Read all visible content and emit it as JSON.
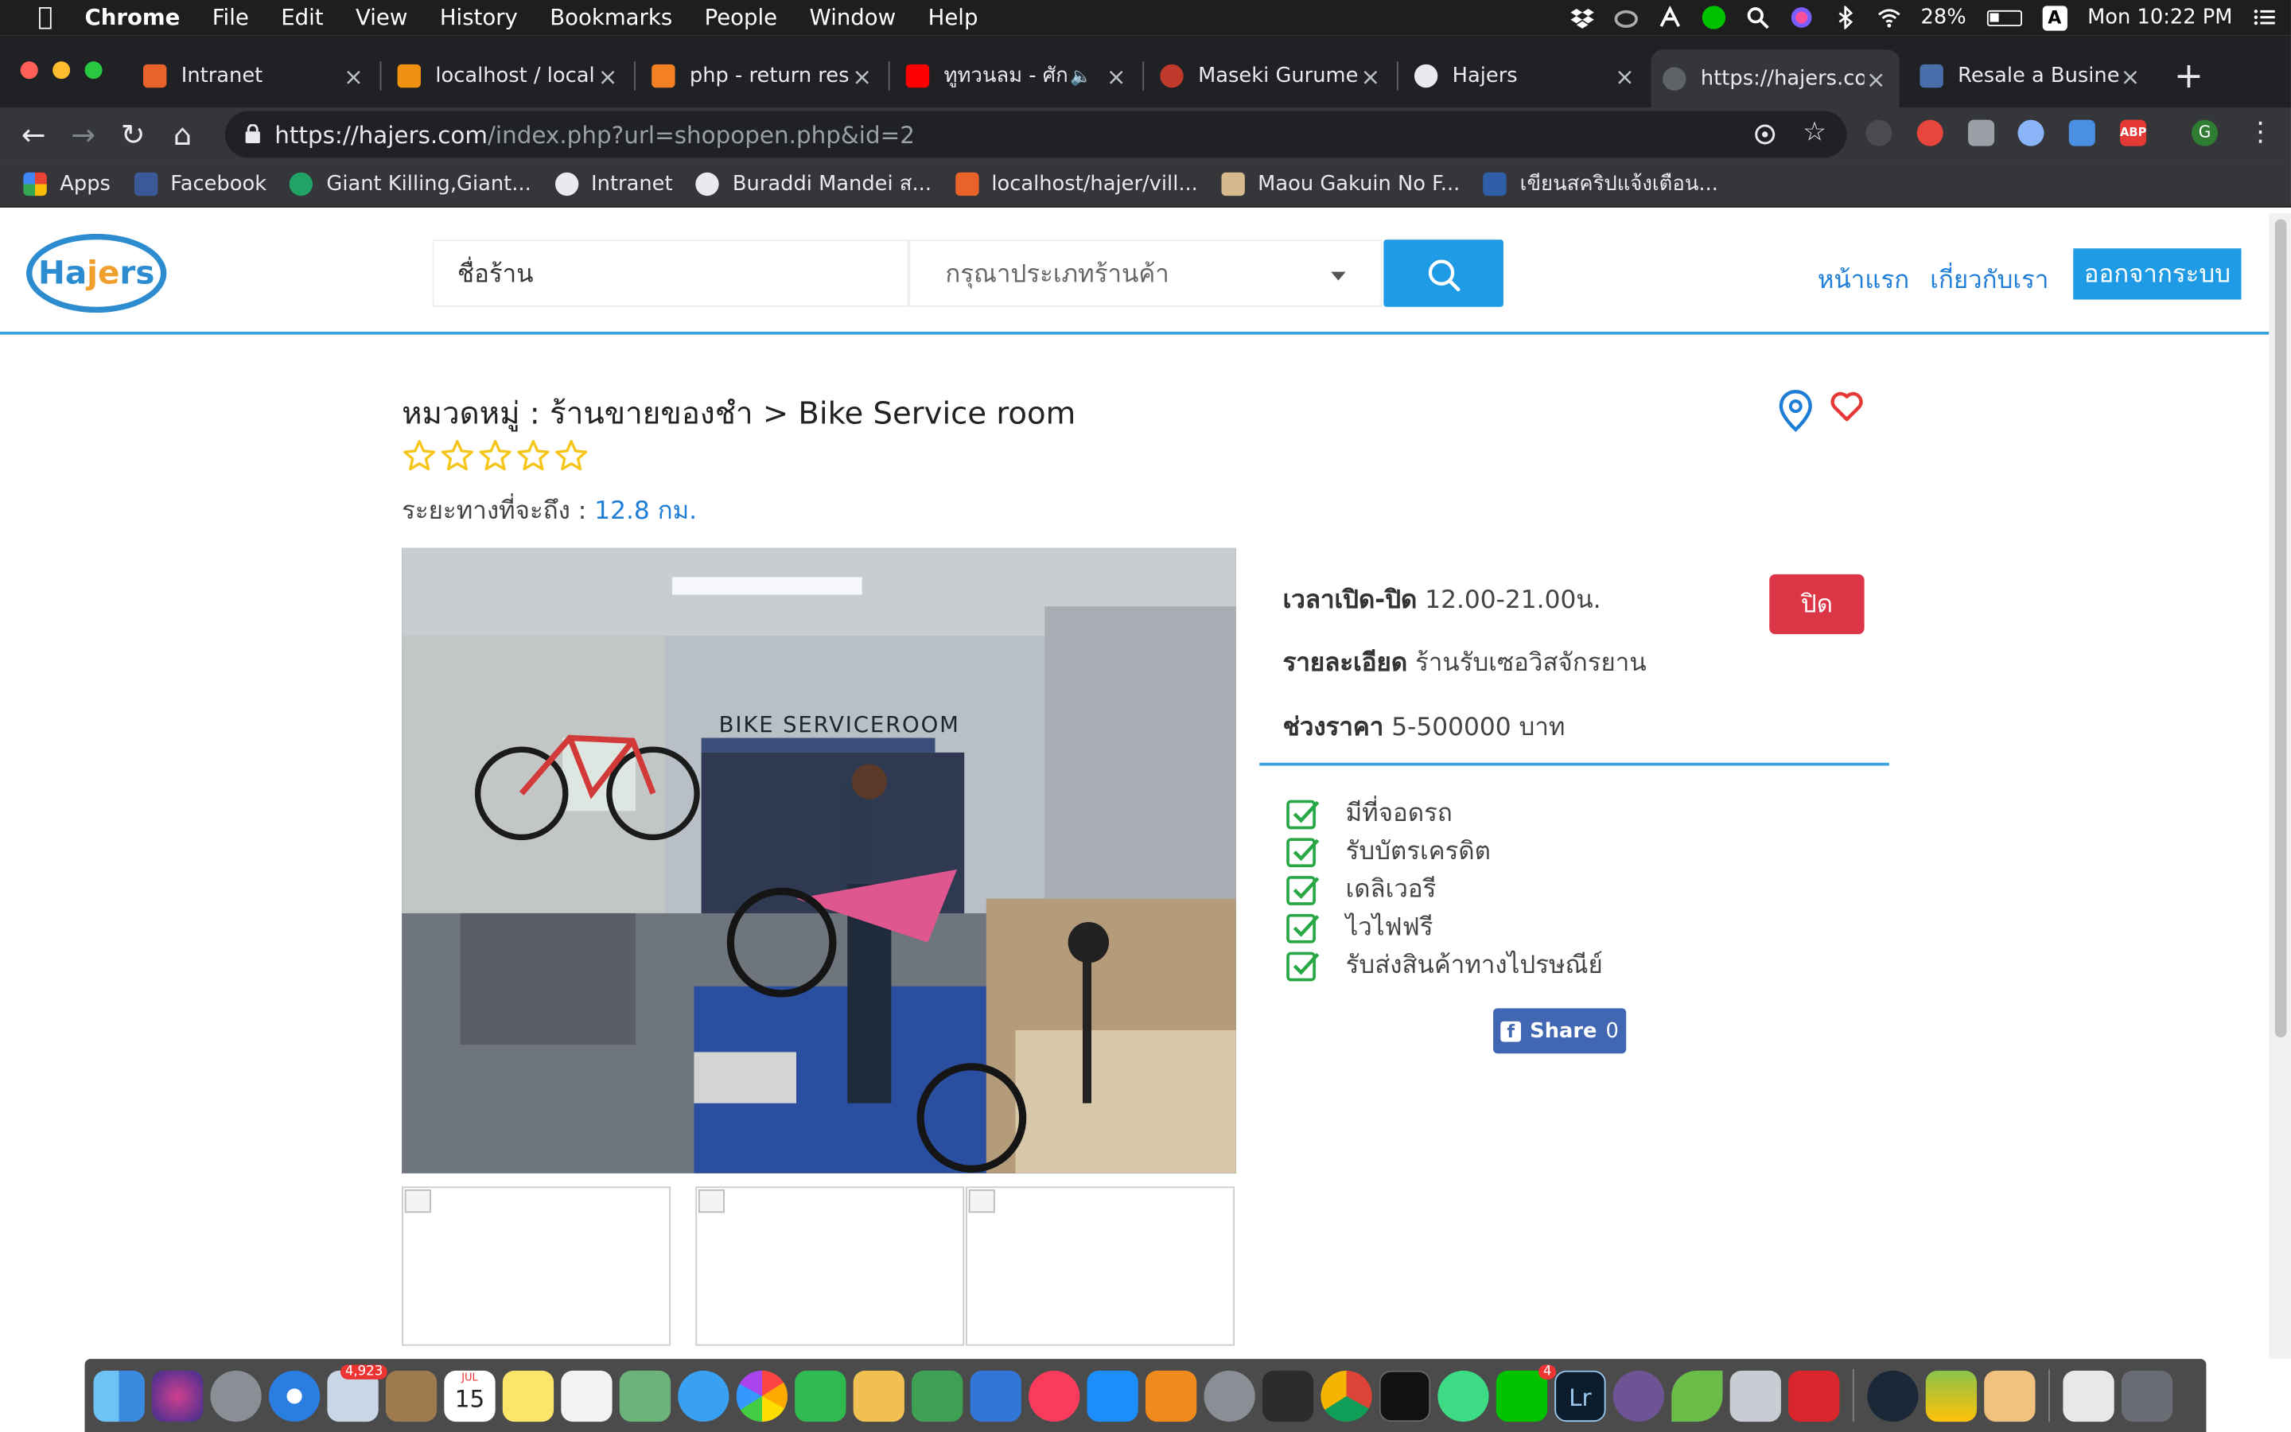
{
  "menubar": {
    "app": "Chrome",
    "items": [
      "File",
      "Edit",
      "View",
      "History",
      "Bookmarks",
      "People",
      "Window",
      "Help"
    ],
    "battery": "28%",
    "input_source": "A",
    "clock": "Mon 10:22 PM"
  },
  "tabs": [
    {
      "title": "Intranet",
      "color": "#e8622a"
    },
    {
      "title": "localhost / localh",
      "color": "#f29111"
    },
    {
      "title": "php - return resu",
      "color": "#f48024"
    },
    {
      "title": "ทูทวนลม - ศักด",
      "color": "#ff0000"
    },
    {
      "title": "Maseki Gurume:",
      "color": "#c0392b"
    },
    {
      "title": "Hajers",
      "color": "#e8eaed"
    },
    {
      "title": "https://hajers.co",
      "color": "#5f6368"
    },
    {
      "title": "Resale a Busine:",
      "color": "#4a6ea9"
    }
  ],
  "omnibox": {
    "host": "https://hajers.com",
    "path": "/index.php?url=shopopen.php&id=2"
  },
  "bookmarks": [
    {
      "label": "Apps",
      "color": "#ea4335"
    },
    {
      "label": "Facebook",
      "color": "#3b5998"
    },
    {
      "label": "Giant Killing,Giant...",
      "color": "#21a366"
    },
    {
      "label": "Intranet",
      "color": "#e8eaed"
    },
    {
      "label": "Buraddi Mandei ส...",
      "color": "#e8eaed"
    },
    {
      "label": "localhost/hajer/vill...",
      "color": "#e8622a"
    },
    {
      "label": "Maou Gakuin No F...",
      "color": "#d6b98c"
    },
    {
      "label": "เขียนสคริปแจ้งเตือน...",
      "color": "#2e5ea8"
    }
  ],
  "site": {
    "logo": {
      "prefix": "Ha",
      "middle": "je",
      "suffix": "rs"
    },
    "search": {
      "name_placeholder": "ชื่อร้าน",
      "type_placeholder": "กรุณาประเภทร้านค้า"
    },
    "nav": {
      "home": "หน้าแรก",
      "about": "เกี่ยวกับเรา",
      "logout": "ออกจากระบบ"
    },
    "shop": {
      "title": "หมวดหมู่ : ร้านขายของชำ > Bike Service room",
      "rating": 0,
      "rating_max": 5,
      "distance_label": "ระยะทางที่จะถึง :",
      "distance_value": "12.8 กม.",
      "photo_sign": "BIKE SERVICEROOM",
      "hours_label": "เวลาเปิด-ปิด",
      "hours_value": "12.00-21.00น.",
      "detail_label": "รายละเอียด",
      "detail_value": "ร้านรับเซอวิสจักรยาน",
      "price_label": "ช่วงราคา",
      "price_value": "5-500000 บาท",
      "status_button": "ปิด",
      "features": [
        "มีที่จอดรถ",
        "รับบัตรเครดิต",
        "เดลิเวอรี",
        "ไวไฟฟรี",
        "รับส่งสินค้าทางไปรษณีย์"
      ],
      "share_label": "Share",
      "share_count": "0"
    }
  },
  "dock": {
    "mail_badge": "4,923",
    "calendar_month": "JUL",
    "calendar_day": "15",
    "line_badge": "4",
    "lightroom": "Lr"
  },
  "colors": {
    "accent": "#1e9be4",
    "link": "#1e7dd6",
    "danger": "#dc3545",
    "star": "#f5c518",
    "check": "#28a745"
  }
}
